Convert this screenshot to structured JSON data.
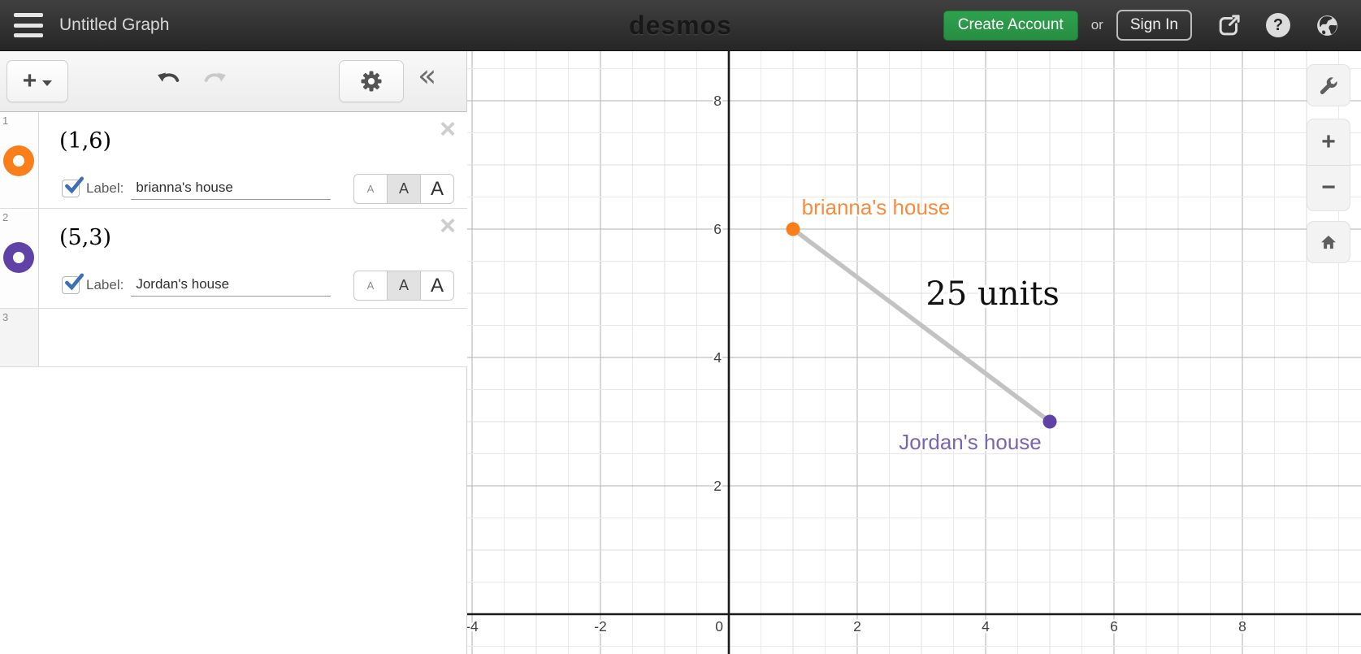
{
  "topbar": {
    "title": "Untitled Graph",
    "logo": "desmos",
    "create_account_label": "Create Account",
    "or_label": "or",
    "sign_in_label": "Sign In",
    "help_glyph": "?"
  },
  "panel_toolbar": {
    "add_label": "+",
    "collapse_glyph": "«"
  },
  "expressions": [
    {
      "index": "1",
      "latex": "(1,6)",
      "dot_css": "background:#fa7e19",
      "label_checked": true,
      "label_caption": "Label:",
      "label_value": "brianna's house",
      "close_glyph": "×",
      "selected_size": "medium"
    },
    {
      "index": "2",
      "latex": "(5,3)",
      "dot_css": "background:#6042a6",
      "label_checked": true,
      "label_caption": "Label:",
      "label_value": "Jordan's house",
      "close_glyph": "×",
      "selected_size": "medium"
    },
    {
      "index": "3",
      "latex": ""
    }
  ],
  "size_buttons": {
    "small": "A",
    "medium": "A",
    "large": "A"
  },
  "graph_controls": {
    "zoom_in": "+",
    "zoom_out": "−"
  },
  "chart_data": {
    "type": "scatter",
    "points": [
      {
        "x": 1,
        "y": 6,
        "color": "#fa7e19",
        "label": "brianna's house",
        "label_color": "#f78c3e",
        "label_offset": [
          102,
          -27
        ]
      },
      {
        "x": 5,
        "y": 3,
        "color": "#6042a6",
        "label": "Jordan's house",
        "label_color": "#7766b2",
        "label_offset": [
          -98,
          25
        ]
      }
    ],
    "segments": [
      {
        "from": [
          1,
          6
        ],
        "to": [
          5,
          3
        ],
        "color": "#c2c2c2",
        "width": 5.5
      }
    ],
    "annotations": [
      {
        "text": "25 units",
        "x": 4.11,
        "y": 5.0,
        "font_size": 40,
        "color": "#111111"
      }
    ],
    "axis": {
      "x_tick_labels": [
        -4,
        -2,
        0,
        2,
        4,
        6,
        8
      ],
      "y_tick_labels": [
        2,
        4,
        6,
        8
      ],
      "minor_step": 0.5,
      "major_step": 2,
      "x_visible_range": [
        -4.07,
        9.85
      ],
      "y_visible_range": [
        -0.62,
        8.77
      ]
    }
  }
}
